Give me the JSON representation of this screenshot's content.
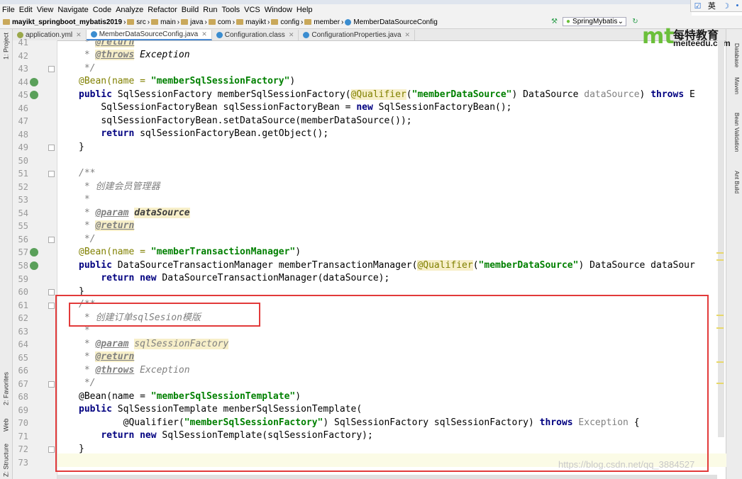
{
  "menu": [
    "File",
    "Edit",
    "View",
    "Navigate",
    "Code",
    "Analyze",
    "Refactor",
    "Build",
    "Run",
    "Tools",
    "VCS",
    "Window",
    "Help"
  ],
  "ime": {
    "lang": "英"
  },
  "breadcrumb": [
    "mayikt_springboot_mybatis2019",
    "src",
    "main",
    "java",
    "com",
    "mayikt",
    "config",
    "member",
    "MemberDataSourceConfig"
  ],
  "run_config": "SpringMybatis",
  "tabs": [
    {
      "label": "application.yml",
      "color": "#9aa84a",
      "active": false
    },
    {
      "label": "MemberDataSourceConfig.java",
      "color": "#3b8dd0",
      "active": true
    },
    {
      "label": "Configuration.class",
      "color": "#3b8dd0",
      "active": false
    },
    {
      "label": "ConfigurationProperties.java",
      "color": "#3b8dd0",
      "active": false
    }
  ],
  "left_tools": {
    "project": "1: Project",
    "favorites": "2: Favorites",
    "web": "Web",
    "structure": "Z: Structure"
  },
  "right_tools": {
    "database": "Database",
    "maven": "Maven",
    "bean": "Bean Validation",
    "ant": "Ant Build"
  },
  "logo": {
    "mark": "mt",
    "name": "每特教育",
    "url": "meiteedu.com"
  },
  "line_numbers": [
    "41",
    "42",
    "43",
    "44",
    "45",
    "46",
    "47",
    "48",
    "49",
    "50",
    "51",
    "52",
    "53",
    "54",
    "55",
    "56",
    "57",
    "58",
    "59",
    "60",
    "61",
    "62",
    "63",
    "64",
    "65",
    "66",
    "67",
    "68",
    "69",
    "70",
    "71",
    "72",
    "73"
  ],
  "code": {
    "l41": "@return",
    "l42_tag": "@throws",
    "l42_rest": " Exception",
    "l44_ann": "@Bean(name = ",
    "l44_str": "\"memberSqlSessionFactory\"",
    "l45_a": "public",
    "l45_b": " SqlSessionFactory memberSqlSessionFactory(",
    "l45_c": "@Qualifier",
    "l45_d": "(",
    "l45_e": "\"memberDataSource\"",
    "l45_f": ") DataSource ",
    "l45_g": "dataSource",
    "l45_h": ") ",
    "l45_i": "throws",
    "l45_j": " E",
    "l46_a": "SqlSessionFactoryBean sqlSessionFactoryBean = ",
    "l46_b": "new",
    "l46_c": " SqlSessionFactoryBean();",
    "l47": "sqlSessionFactoryBean.setDataSource(memberDataSource());",
    "l48_a": "return",
    "l48_b": " sqlSessionFactoryBean.getObject();",
    "l49": "}",
    "l51": "/**",
    "l52": " * 创建会员管理器",
    "l53": " *",
    "l54_tag": "@param",
    "l54_rest": "dataSource",
    "l55_tag": "@return",
    "l56": " */",
    "l57_ann": "@Bean(name = ",
    "l57_str": "\"memberTransactionManager\"",
    "l58_a": "public",
    "l58_b": " DataSourceTransactionManager memberTransactionManager(",
    "l58_c": "@Qualifier",
    "l58_d": "(",
    "l58_e": "\"memberDataSource\"",
    "l58_f": ") DataSource dataSour",
    "l59_a": "return",
    "l59_b": " ",
    "l59_c": "new",
    "l59_d": " DataSourceTransactionManager(dataSource);",
    "l60": "}",
    "l61": "/**",
    "l62": " * 创建订单sqlSesion模版",
    "l63": " *",
    "l64_tag": "@param",
    "l64_rest": "sqlSessionFactory",
    "l65_tag": "@return",
    "l66_tag": "@throws",
    "l66_rest": " Exception",
    "l67": " */",
    "l68_ann": "@Bean(name = ",
    "l68_str": "\"memberSqlSessionTemplate\"",
    "l69_a": "public",
    "l69_b": " SqlSessionTemplate menberSqlSessionTemplate(",
    "l70_a": "@Qualifier(",
    "l70_b": "\"memberSqlSessionFactory\"",
    "l70_c": ") SqlSessionFactory sqlSessionFactory) ",
    "l70_d": "throws",
    "l70_e": " Exception",
    "l70_f": " {",
    "l71_a": "return",
    "l71_b": " ",
    "l71_c": "new",
    "l71_d": " SqlSessionTemplate(sqlSessionFactory);",
    "l72": "}",
    "l43": " */",
    "star": " * "
  },
  "watermark": "https://blog.csdn.net/qq_3884527"
}
